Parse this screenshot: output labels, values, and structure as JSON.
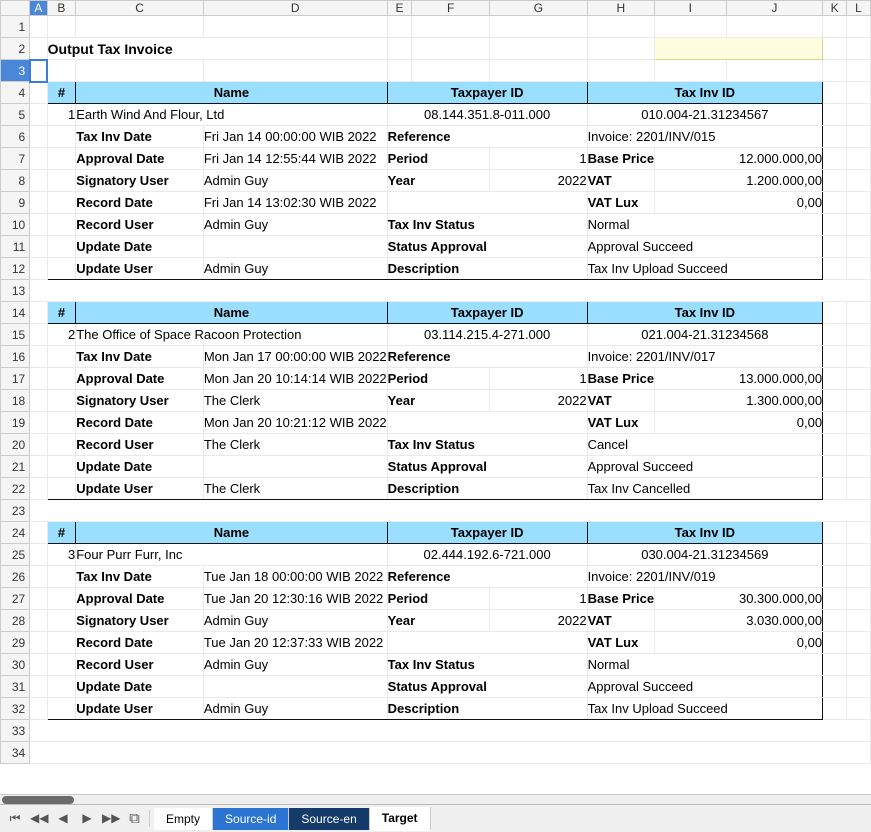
{
  "columns": [
    "A",
    "B",
    "C",
    "D",
    "E",
    "F",
    "G",
    "H",
    "I",
    "J",
    "K",
    "L"
  ],
  "rows_count": 34,
  "selected_col": "A",
  "selected_row": 3,
  "title": "Output Tax Invoice",
  "headers": {
    "num": "#",
    "name": "Name",
    "taxpayer": "Taxpayer ID",
    "taxinv": "Tax Inv ID"
  },
  "labels": {
    "tax_inv_date": "Tax Inv Date",
    "approval_date": "Approval Date",
    "signatory_user": "Signatory User",
    "record_date": "Record Date",
    "record_user": "Record User",
    "update_date": "Update Date",
    "update_user": "Update User",
    "reference": "Reference",
    "period": "Period",
    "year": "Year",
    "tax_inv_status": "Tax Inv Status",
    "status_approval": "Status Approval",
    "description": "Description",
    "base_price": "Base Price",
    "vat": "VAT",
    "vat_lux": "VAT Lux"
  },
  "records": [
    {
      "num": "1",
      "name": "Earth Wind And Flour, Ltd",
      "taxpayer": "08.144.351.8-011.000",
      "taxinv": "010.004-21.31234567",
      "tax_inv_date": "Fri Jan 14 00:00:00 WIB 2022",
      "approval_date": "Fri Jan 14 12:55:44 WIB 2022",
      "record_date": "Fri Jan 14 13:02:30 WIB 2022",
      "signatory_user": "Admin Guy",
      "record_user": "Admin Guy",
      "update_user": "Admin Guy",
      "reference": "Invoice: 2201/INV/015",
      "period": "1",
      "year": "2022",
      "base_price": "12.000.000,00",
      "vat": "1.200.000,00",
      "vat_lux": "0,00",
      "tax_inv_status": "Normal",
      "status_approval": "Approval Succeed",
      "description": "Tax Inv Upload Succeed"
    },
    {
      "num": "2",
      "name": "The Office of Space Racoon Protection",
      "taxpayer": "03.114.215.4-271.000",
      "taxinv": "021.004-21.31234568",
      "tax_inv_date": "Mon Jan 17 00:00:00 WIB 2022",
      "approval_date": "Mon Jan 20 10:14:14 WIB 2022",
      "record_date": "Mon Jan 20 10:21:12 WIB 2022",
      "signatory_user": "The Clerk",
      "record_user": "The Clerk",
      "update_user": "The Clerk",
      "reference": "Invoice: 2201/INV/017",
      "period": "1",
      "year": "2022",
      "base_price": "13.000.000,00",
      "vat": "1.300.000,00",
      "vat_lux": "0,00",
      "tax_inv_status": "Cancel",
      "status_approval": "Approval Succeed",
      "description": "Tax Inv Cancelled"
    },
    {
      "num": "3",
      "name": "Four Purr Furr, Inc",
      "taxpayer": "02.444.192.6-721.000",
      "taxinv": "030.004-21.31234569",
      "tax_inv_date": "Tue Jan 18 00:00:00 WIB 2022",
      "approval_date": "Tue Jan 20 12:30:16 WIB 2022",
      "record_date": "Tue Jan 20 12:37:33 WIB 2022",
      "signatory_user": "Admin Guy",
      "record_user": "Admin Guy",
      "update_user": "Admin Guy",
      "reference": "Invoice: 2201/INV/019",
      "period": "1",
      "year": "2022",
      "base_price": "30.300.000,00",
      "vat": "3.030.000,00",
      "vat_lux": "0,00",
      "tax_inv_status": "Normal",
      "status_approval": "Approval Succeed",
      "description": "Tax Inv Upload Succeed"
    }
  ],
  "tabs": {
    "empty": "Empty",
    "source_id": "Source-id",
    "source_en": "Source-en",
    "target": "Target"
  }
}
